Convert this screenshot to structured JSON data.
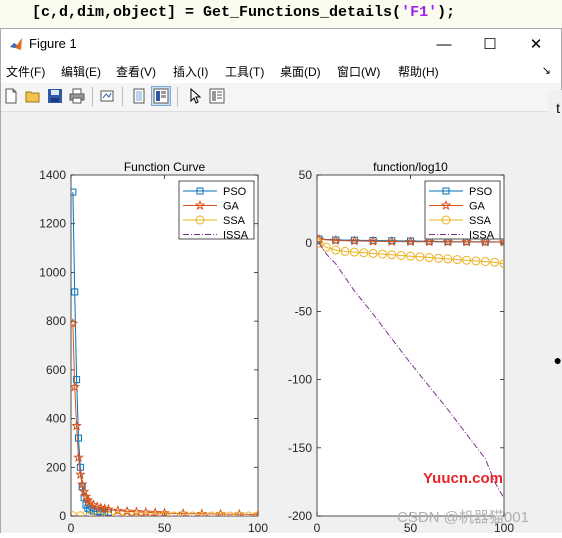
{
  "code": {
    "prefix": "[c,d,dim,object] = Get_Functions_details(",
    "string": "'F1'",
    "suffix": ");"
  },
  "background_glyphs": {
    "right_text": "t",
    "right_dot": "●"
  },
  "window": {
    "title": "Figure 1",
    "controls": {
      "minimize": "—",
      "maximize": "☐",
      "close": "✕"
    }
  },
  "menu": [
    "文件(F)",
    "编辑(E)",
    "查看(V)",
    "插入(I)",
    "工具(T)",
    "桌面(D)",
    "窗口(W)",
    "帮助(H)"
  ],
  "menu_overflow": "↘",
  "toolbar": [
    "new-figure-icon",
    "open-file-icon",
    "save-icon",
    "print-icon",
    "link-plot-icon",
    "hide-plot-tools-icon",
    "show-plot-tools-icon",
    "edit-plot-cursor-icon",
    "property-inspector-icon"
  ],
  "watermarks": {
    "site": "Yuucn.com",
    "author": "CSDN @机器猫001"
  },
  "colors": {
    "PSO": "#0072bd",
    "GA": "#d95319",
    "SSA": "#edb120",
    "ISSA": "#7e2f8e"
  },
  "chart_data": [
    {
      "type": "line",
      "title": "Function Curve",
      "xlabel": "",
      "ylabel": "",
      "xlim": [
        0,
        100
      ],
      "ylim": [
        0,
        1400
      ],
      "xticks": [
        0,
        50,
        100
      ],
      "yticks": [
        0,
        200,
        400,
        600,
        800,
        1000,
        1200,
        1400
      ],
      "legend_position": "top-right",
      "series": [
        {
          "name": "PSO",
          "marker": "square",
          "x": [
            1,
            2,
            3,
            4,
            5,
            6,
            7,
            8,
            9,
            10,
            12,
            14,
            16,
            18,
            20
          ],
          "y": [
            1330,
            920,
            560,
            320,
            200,
            120,
            75,
            45,
            32,
            25,
            20,
            18,
            17,
            16,
            15
          ]
        },
        {
          "name": "GA",
          "marker": "star",
          "x": [
            1,
            2,
            3,
            4,
            5,
            6,
            7,
            8,
            9,
            10,
            12,
            14,
            16,
            18,
            20,
            25,
            30,
            35,
            40,
            45,
            50,
            60,
            70,
            80,
            90,
            100
          ],
          "y": [
            790,
            530,
            370,
            240,
            170,
            130,
            100,
            80,
            65,
            55,
            45,
            38,
            33,
            30,
            27,
            22,
            19,
            17,
            15,
            13,
            12,
            10,
            9,
            8,
            7,
            6
          ]
        },
        {
          "name": "SSA",
          "marker": "circle",
          "x": [
            1,
            5,
            10,
            15,
            20,
            25,
            30,
            35,
            40,
            45,
            50,
            55,
            60,
            65,
            70,
            75,
            80,
            85,
            90,
            95,
            100
          ],
          "y": [
            1,
            1,
            0,
            0,
            0,
            0,
            0,
            0,
            0,
            0,
            0,
            0,
            0,
            0,
            0,
            0,
            0,
            0,
            0,
            0,
            0
          ]
        },
        {
          "name": "ISSA",
          "marker": "none",
          "x": [
            1,
            10,
            20,
            30,
            40,
            50,
            60,
            70,
            80,
            90,
            100
          ],
          "y": [
            0,
            0,
            0,
            0,
            0,
            0,
            0,
            0,
            0,
            0,
            0
          ]
        }
      ]
    },
    {
      "type": "line",
      "title": "function/log10",
      "xlabel": "",
      "ylabel": "",
      "xlim": [
        0,
        100
      ],
      "ylim": [
        -200,
        50
      ],
      "xticks": [
        0,
        50,
        100
      ],
      "yticks": [
        -200,
        -150,
        -100,
        -50,
        0,
        50
      ],
      "legend_position": "top-right",
      "series": [
        {
          "name": "PSO",
          "marker": "square",
          "x": [
            1,
            10,
            20,
            30,
            40,
            50,
            60,
            70,
            80,
            90,
            100
          ],
          "y": [
            3.1,
            2.4,
            2.2,
            2.0,
            1.8,
            1.6,
            1.4,
            1.2,
            1.1,
            1.0,
            0.9
          ]
        },
        {
          "name": "GA",
          "marker": "star",
          "x": [
            1,
            10,
            20,
            30,
            40,
            50,
            60,
            70,
            80,
            90,
            100
          ],
          "y": [
            2.9,
            2.0,
            1.6,
            1.4,
            1.2,
            1.1,
            1.0,
            0.9,
            0.9,
            0.8,
            0.8
          ]
        },
        {
          "name": "SSA",
          "marker": "circle",
          "x": [
            1,
            5,
            10,
            15,
            20,
            25,
            30,
            35,
            40,
            45,
            50,
            55,
            60,
            65,
            70,
            75,
            80,
            85,
            90,
            95,
            100
          ],
          "y": [
            0,
            -3,
            -5,
            -6,
            -6.5,
            -7,
            -7.5,
            -8,
            -8.5,
            -9,
            -9.5,
            -10,
            -10.5,
            -11,
            -11.5,
            -12,
            -12.5,
            -13,
            -13.5,
            -14,
            -15
          ]
        },
        {
          "name": "ISSA",
          "marker": "none",
          "x": [
            1,
            5,
            10,
            20,
            30,
            40,
            50,
            60,
            70,
            80,
            90,
            95,
            100
          ],
          "y": [
            0,
            -8,
            -15,
            -35,
            -52,
            -70,
            -88,
            -105,
            -122,
            -140,
            -158,
            -175,
            -187
          ]
        }
      ]
    }
  ]
}
